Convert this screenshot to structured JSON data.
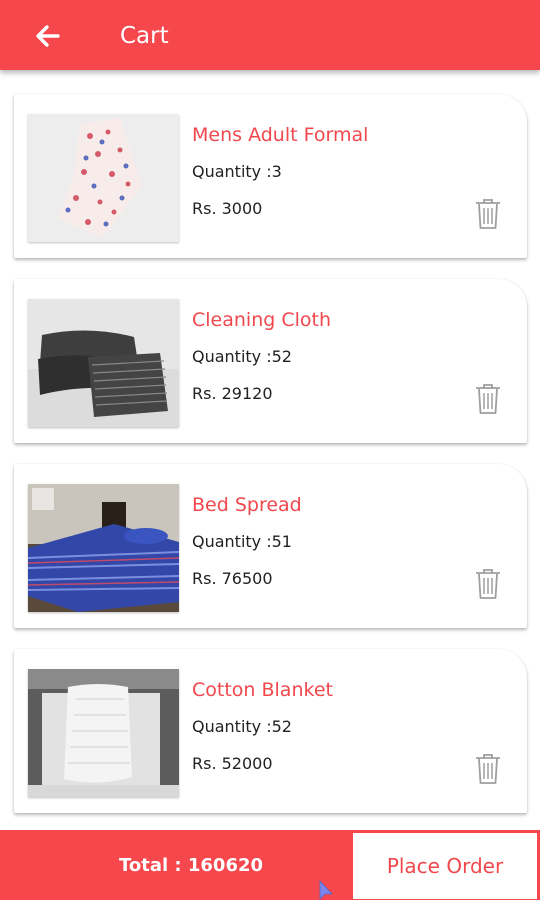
{
  "header": {
    "title": "Cart",
    "back_icon": "arrow-left-icon"
  },
  "cart": {
    "items": [
      {
        "name": "Mens Adult Formal",
        "quantity": "Quantity :3",
        "price": "Rs. 3000",
        "image": "patterned-fabric-image"
      },
      {
        "name": "Cleaning Cloth",
        "quantity": "Quantity :52",
        "price": "Rs. 29120",
        "image": "stacked-cloths-image"
      },
      {
        "name": "Bed Spread",
        "quantity": "Quantity :51",
        "price": "Rs. 76500",
        "image": "striped-bedspread-image"
      },
      {
        "name": "Cotton Blanket",
        "quantity": "Quantity :52",
        "price": "Rs. 52000",
        "image": "white-blanket-image"
      }
    ],
    "delete_icon": "trash-icon"
  },
  "footer": {
    "total": "Total : 160620",
    "place_order": "Place Order"
  },
  "colors": {
    "accent": "#f5474c",
    "text": "#222222",
    "icon": "#9e9e9e"
  }
}
